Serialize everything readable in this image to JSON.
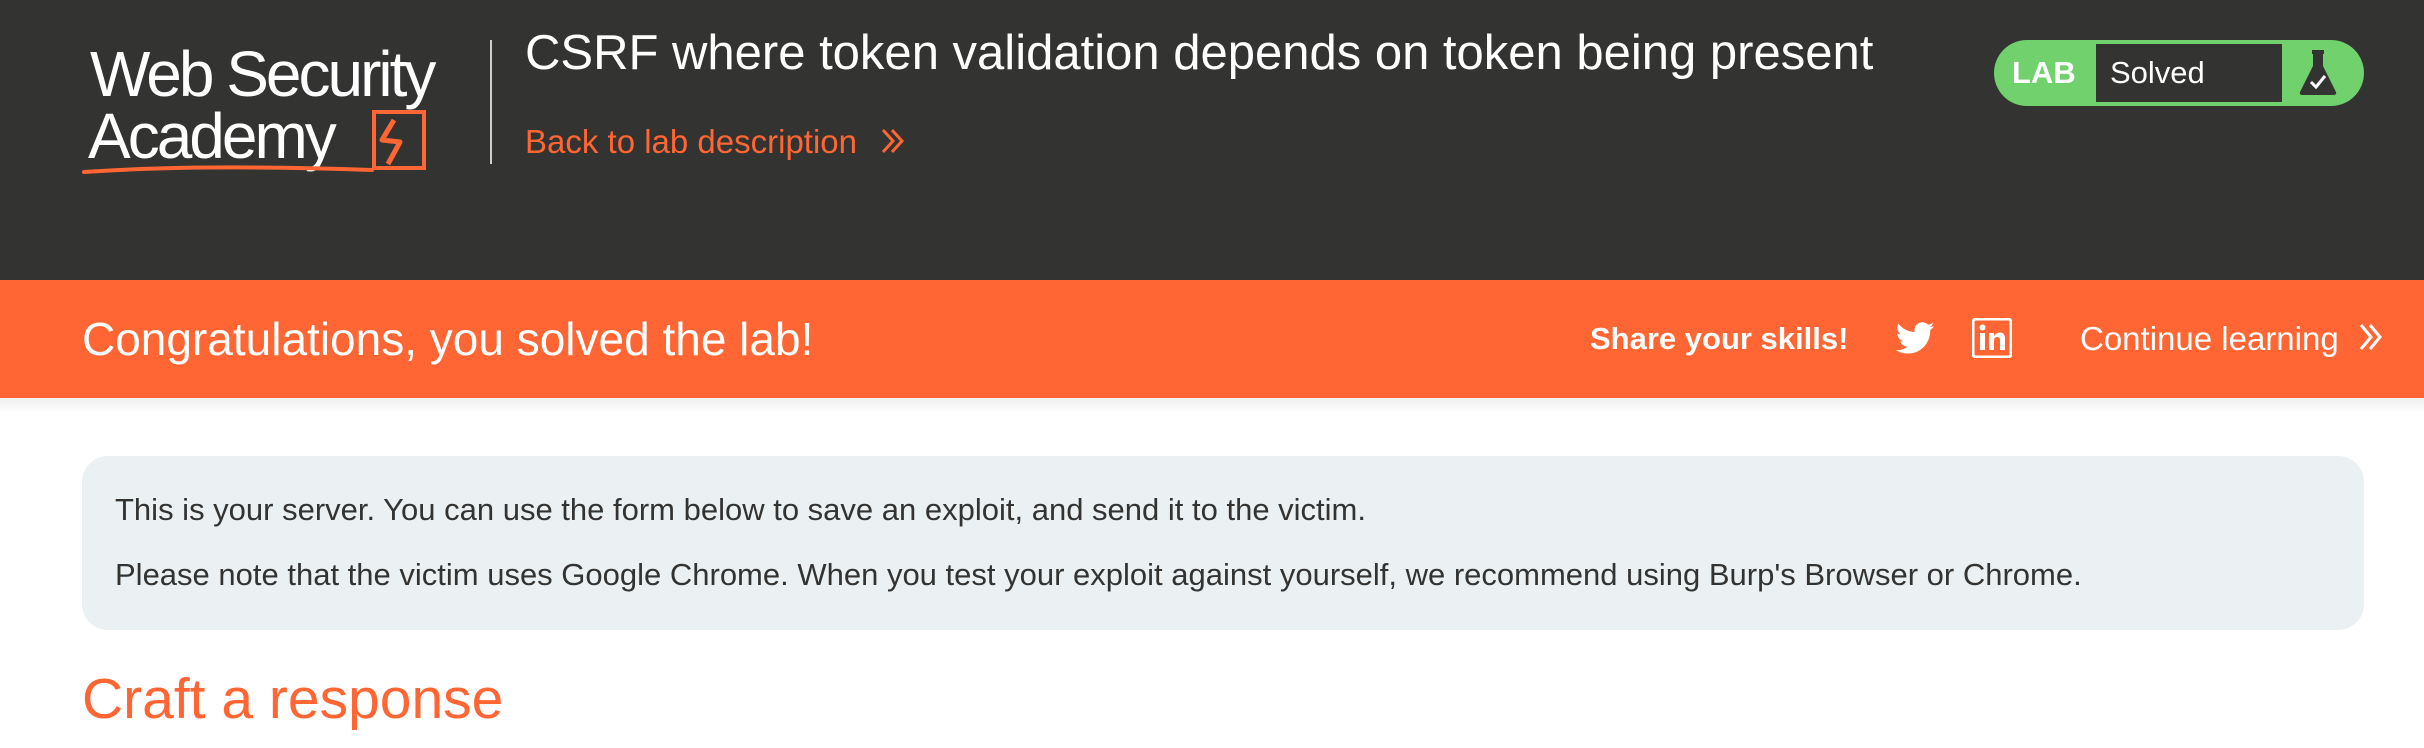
{
  "header": {
    "logo": {
      "line1": "Web Security",
      "line2": "Academy"
    },
    "lab_title": "CSRF where token validation depends on token being present",
    "back_link": "Back to lab description",
    "back_link_icon": "double-chevron-right-icon",
    "lab_badge": {
      "label": "LAB",
      "status": "Solved",
      "icon": "flask-icon"
    }
  },
  "banner": {
    "title": "Congratulations, you solved the lab!",
    "share_label": "Share your skills!",
    "share_icons": [
      "twitter-icon",
      "linkedin-icon"
    ],
    "continue_link": "Continue learning",
    "continue_icon": "double-chevron-right-icon"
  },
  "info": {
    "line1": "This is your server. You can use the form below to save an exploit, and send it to the victim.",
    "line2": "Please note that the victim uses Google Chrome. When you test your exploit against yourself, we recommend using Burp's Browser or Chrome."
  },
  "section": {
    "heading": "Craft a response"
  },
  "colors": {
    "header_bg": "#333332",
    "accent_orange": "#ff6633",
    "solved_green": "#70d16d",
    "info_bg": "#ebf0f2",
    "text_dark": "#333332"
  }
}
